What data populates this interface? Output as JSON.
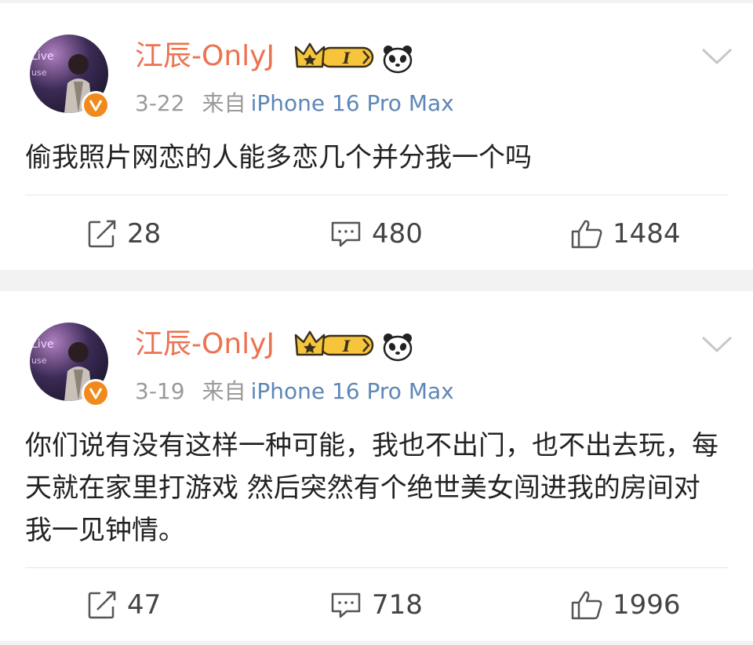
{
  "posts": [
    {
      "username": "江辰-OnlyJ",
      "date": "3-22",
      "via": "来自",
      "device": "iPhone 16 Pro Max",
      "content": "偷我照片网恋的人能多恋几个并分我一个吗",
      "reposts": "28",
      "comments": "480",
      "likes": "1484"
    },
    {
      "username": "江辰-OnlyJ",
      "date": "3-19",
      "via": "来自",
      "device": "iPhone 16 Pro Max",
      "content": "你们说有没有这样一种可能，我也不出门，也不出去玩，每天就在家里打游戏 然后突然有个绝世美女闯进我的房间对我一见钟情。",
      "reposts": "47",
      "comments": "718",
      "likes": "1996"
    }
  ],
  "badge_text": "I",
  "colors": {
    "username": "#eb7350",
    "device": "#5f86b8",
    "verified_badge": "#f08a1c",
    "meta": "#9a9a9a"
  },
  "icons": [
    "avatar",
    "verified-badge-icon",
    "member-crown-icon",
    "panda-icon",
    "chevron-down-icon",
    "repost-icon",
    "comment-icon",
    "like-icon"
  ]
}
